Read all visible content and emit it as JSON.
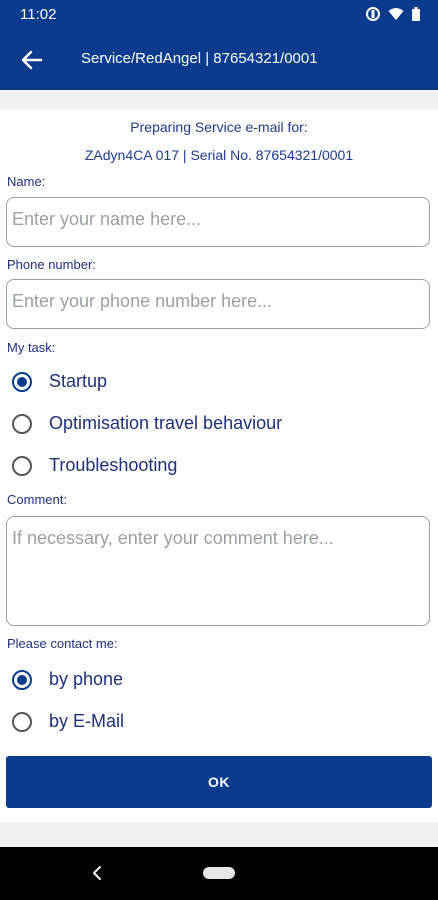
{
  "status": {
    "time": "11:02"
  },
  "appbar": {
    "title": "Service/RedAngel | 87654321/0001"
  },
  "form": {
    "heading_line1": "Preparing Service e-mail  for:",
    "heading_line2": "ZAdyn4CA 017 | Serial No. 87654321/0001",
    "name_label": "Name:",
    "name_placeholder": "Enter your name here...",
    "phone_label": "Phone number:",
    "phone_placeholder": "Enter your phone number here...",
    "task_label": "My task:",
    "tasks": [
      {
        "label": "Startup",
        "checked": true
      },
      {
        "label": "Optimisation travel behaviour",
        "checked": false
      },
      {
        "label": "Troubleshooting",
        "checked": false
      }
    ],
    "comment_label": "Comment:",
    "comment_placeholder": "If necessary, enter your comment here...",
    "contact_label": "Please contact me:",
    "contacts": [
      {
        "label": "by phone",
        "checked": true
      },
      {
        "label": "by E-Mail",
        "checked": false
      }
    ],
    "ok_label": "OK"
  },
  "colors": {
    "primary": "#0a3b8c",
    "label_text": "#1e2f7a",
    "placeholder": "#9aa0a6"
  },
  "icons": {
    "back": "arrow-left-icon",
    "system_back": "chevron-left-icon",
    "home": "home-pill-icon"
  }
}
